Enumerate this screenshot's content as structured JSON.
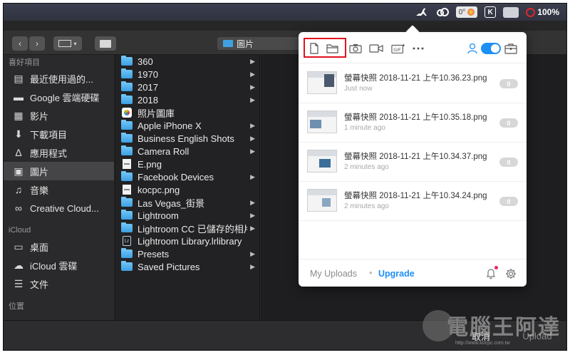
{
  "menubar": {
    "temperature": "0°",
    "k_label": "K",
    "battery": "100%"
  },
  "finder": {
    "path_title": "圖片",
    "sidebar": {
      "sections": [
        {
          "header": "喜好項目",
          "items": [
            {
              "label": "最近使用過的...",
              "icon": "clock-icon"
            },
            {
              "label": "Google 雲端硬碟",
              "icon": "folder-icon"
            },
            {
              "label": "影片",
              "icon": "film-icon"
            },
            {
              "label": "下載項目",
              "icon": "download-icon"
            },
            {
              "label": "應用程式",
              "icon": "apps-icon"
            },
            {
              "label": "圖片",
              "icon": "camera-icon",
              "active": true
            },
            {
              "label": "音樂",
              "icon": "music-icon"
            },
            {
              "label": "Creative Cloud...",
              "icon": "creative-cloud-icon"
            }
          ]
        },
        {
          "header": "iCloud",
          "items": [
            {
              "label": "桌面",
              "icon": "desktop-icon"
            },
            {
              "label": "iCloud 雲碟",
              "icon": "cloud-icon"
            },
            {
              "label": "文件",
              "icon": "document-icon"
            }
          ]
        },
        {
          "header": "位置",
          "items": []
        }
      ]
    },
    "column1": [
      {
        "label": "360",
        "kind": "folder",
        "arrow": true
      },
      {
        "label": "1970",
        "kind": "folder",
        "arrow": true
      },
      {
        "label": "2017",
        "kind": "folder",
        "arrow": true
      },
      {
        "label": "2018",
        "kind": "folder",
        "arrow": true
      },
      {
        "label": "照片圖庫",
        "kind": "photos",
        "arrow": false
      },
      {
        "label": "Apple iPhone X",
        "kind": "folder",
        "arrow": true
      },
      {
        "label": "Business English Shots",
        "kind": "folder",
        "arrow": true
      },
      {
        "label": "Camera Roll",
        "kind": "folder",
        "arrow": true
      },
      {
        "label": "E.png",
        "kind": "png",
        "arrow": false
      },
      {
        "label": "Facebook Devices",
        "kind": "folder",
        "arrow": true
      },
      {
        "label": "kocpc.png",
        "kind": "png",
        "arrow": false
      },
      {
        "label": "Las Vegas_街景",
        "kind": "folder",
        "arrow": true
      },
      {
        "label": "Lightroom",
        "kind": "folder",
        "arrow": true
      },
      {
        "label": "Lightroom CC 已儲存的相片",
        "kind": "folder",
        "arrow": true
      },
      {
        "label": "Lightroom Library.lrlibrary",
        "kind": "lr",
        "arrow": false
      },
      {
        "label": "Presets",
        "kind": "folder",
        "arrow": true
      },
      {
        "label": "Saved Pictures",
        "kind": "folder",
        "arrow": true
      }
    ],
    "cancel_label": "取消",
    "upload_label": "Upload",
    "watermark": "電腦王阿達",
    "watermark_url": "http://www.kocpc.com.tw"
  },
  "popover": {
    "uploads": [
      {
        "name": "螢幕快照 2018-11-21 上午10.36.23.png",
        "time": "Just now",
        "count": "0"
      },
      {
        "name": "螢幕快照 2018-11-21 上午10.35.18.png",
        "time": "1 minute ago",
        "count": "0"
      },
      {
        "name": "螢幕快照 2018-11-21 上午10.34.37.png",
        "time": "2 minutes ago",
        "count": "0"
      },
      {
        "name": "螢幕快照 2018-11-21 上午10.34.24.png",
        "time": "2 minutes ago",
        "count": "0"
      }
    ],
    "footer": {
      "my_uploads": "My Uploads",
      "separator": "•",
      "upgrade": "Upgrade"
    },
    "toolbar_icons": [
      "file-icon",
      "folder-open-icon",
      "camera-icon",
      "video-icon",
      "gif-icon",
      "more-icon",
      "user-icon",
      "toggle-switch",
      "briefcase-icon"
    ],
    "accent_color": "#1e8ff5",
    "highlight_color": "#e0121f"
  }
}
